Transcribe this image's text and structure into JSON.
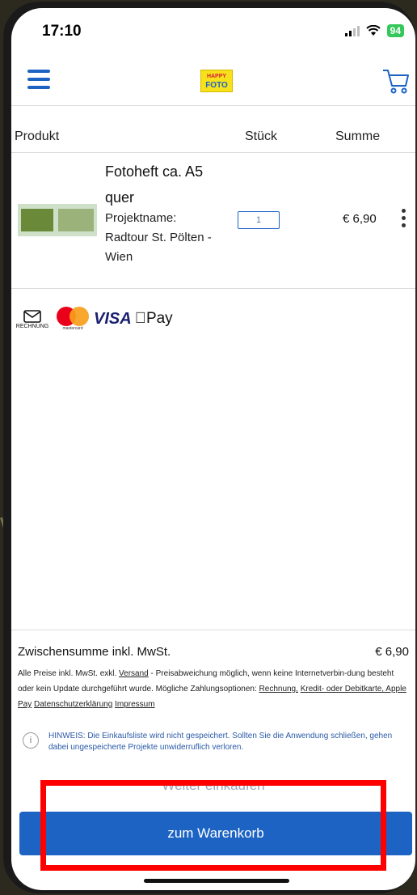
{
  "status_bar": {
    "time": "17:10",
    "battery": "94"
  },
  "header": {
    "logo_line1": "HAPPY",
    "logo_line2": "FOTO"
  },
  "table": {
    "columns": [
      "Produkt",
      "Stück",
      "Summe"
    ],
    "item": {
      "title_line1": "Fotoheft ca. A5",
      "title_line2": "quer",
      "project_label": "Projektname:",
      "project_line1": "Radtour St. Pölten -",
      "project_line2": "Wien",
      "quantity": "1",
      "price": "€ 6,90"
    }
  },
  "payments": {
    "rechnung": "RECHNUNG",
    "mastercard": "mastercard",
    "visa": "VISA",
    "apple_pay": "Pay"
  },
  "summary": {
    "subtotal_label": "Zwischensumme inkl. MwSt.",
    "subtotal_value": "€ 6,90",
    "fine_part1": "Alle Preise inkl. MwSt. exkl.",
    "versand": "Versand",
    "fine_part2": "- Preisabweichung möglich, wenn keine Internetverbin-dung besteht oder kein Update durchgeführt wurde. Mögliche Zahlungsoptionen:",
    "rechnung_link": "Rechnung,",
    "kredit_link": "Kredit- oder Debitkarte, Apple Pay",
    "datenschutz_link": "Datenschutzerklärung",
    "impressum_link": "Impressum",
    "hint": "HINWEIS: Die Einkaufsliste wird nicht gespeichert. Sollten Sie die Anwendung schließen, gehen dabei ungespeicherte Projekte unwiderruflich verloren.",
    "continue_label": "Weiter einkaufen",
    "cart_button_label": "zum Warenkorb"
  },
  "colors": {
    "accent": "#1c63c4",
    "highlight": "#ff0000"
  }
}
